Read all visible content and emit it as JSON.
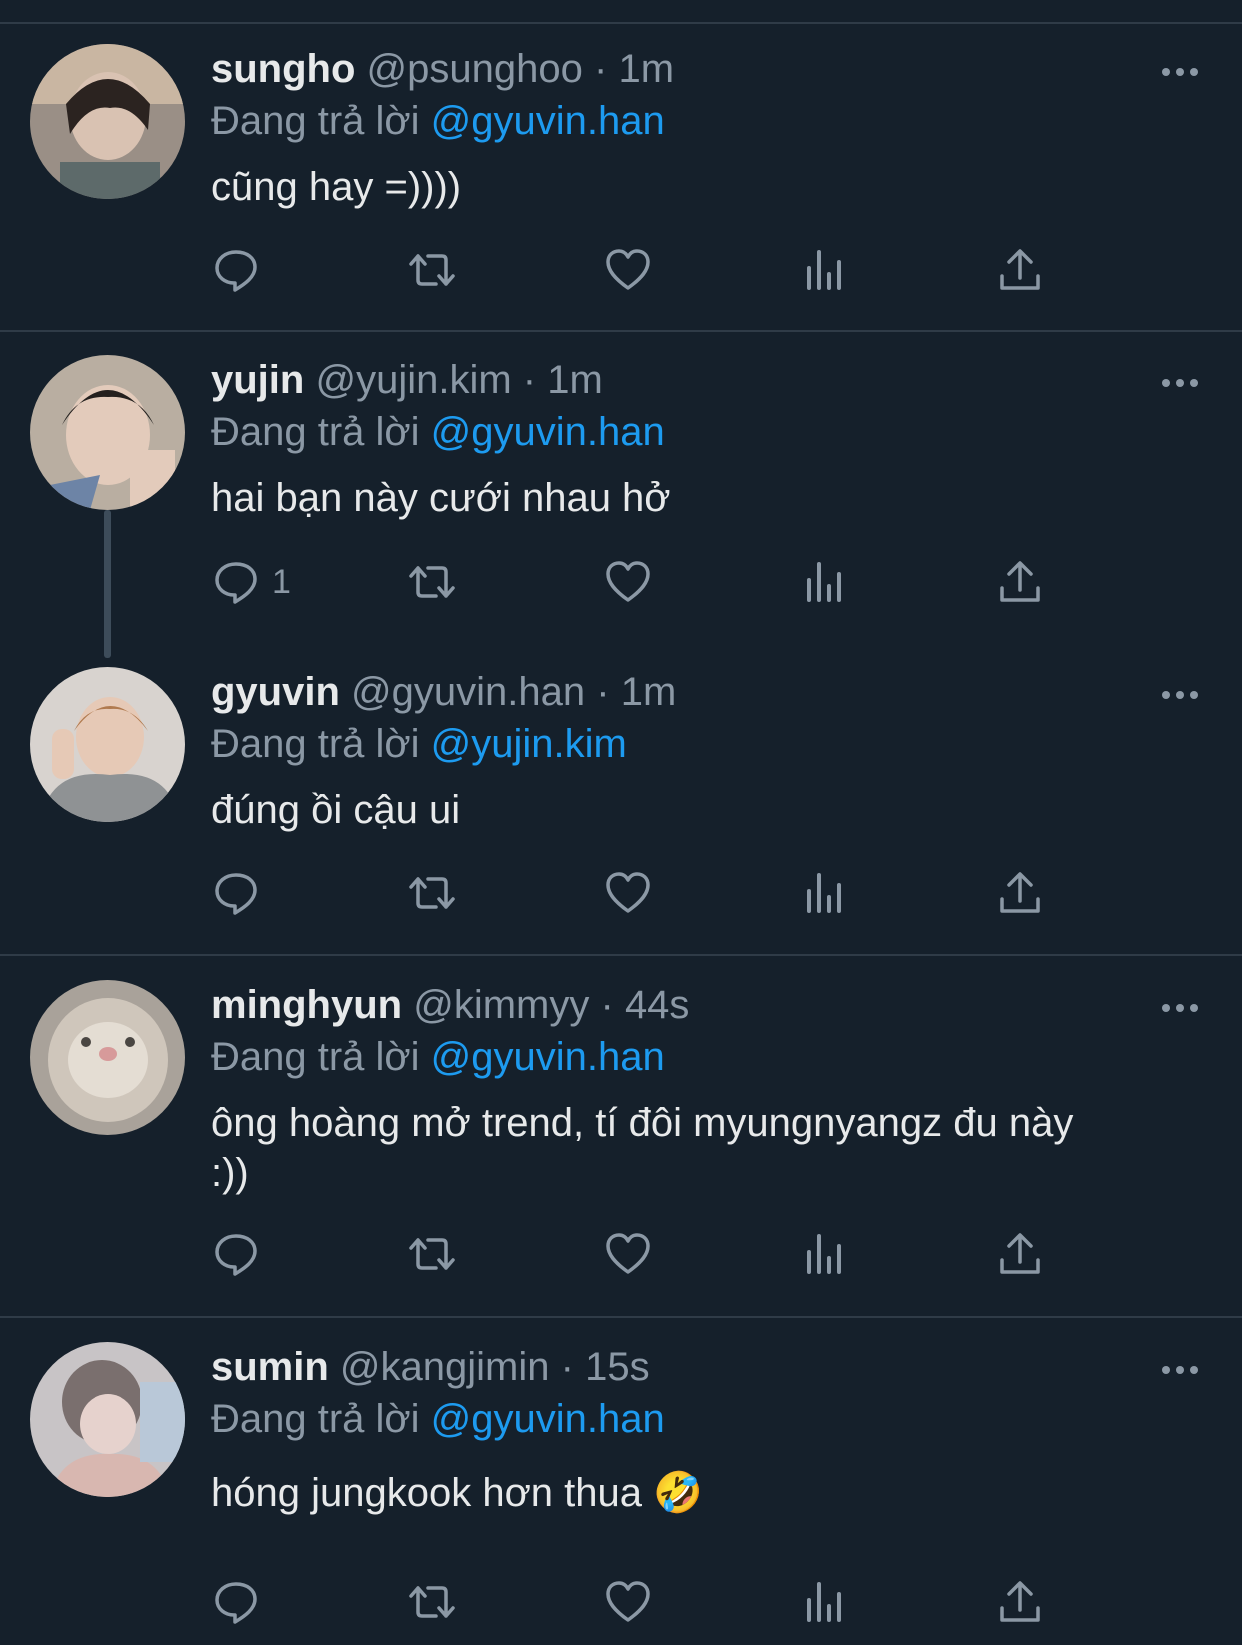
{
  "tweets": [
    {
      "name": "sungho",
      "handle": "@psunghoo",
      "time": "1m",
      "replying_label": "Đang trả lời",
      "replying_to": "@gyuvin.han",
      "text": "cũng hay =))))",
      "reply_count": ""
    },
    {
      "name": "yujin",
      "handle": "@yujin.kim",
      "time": "1m",
      "replying_label": "Đang trả lời",
      "replying_to": "@gyuvin.han",
      "text": "hai bạn này cưới nhau hở",
      "reply_count": "1"
    },
    {
      "name": "gyuvin",
      "handle": "@gyuvin.han",
      "time": "1m",
      "replying_label": "Đang trả lời",
      "replying_to": "@yujin.kim",
      "text": "đúng ồi cậu ui",
      "reply_count": ""
    },
    {
      "name": "minghyun",
      "handle": "@kimmyy",
      "time": "44s",
      "replying_label": "Đang trả lời",
      "replying_to": "@gyuvin.han",
      "text": "ông hoàng mở trend, tí đôi myungnyangz đu này :))",
      "reply_count": ""
    },
    {
      "name": "sumin",
      "handle": "@kangjimin",
      "time": "15s",
      "replying_label": "Đang trả lời",
      "replying_to": "@gyuvin.han",
      "text": "hóng jungkook hơn thua 🤣",
      "reply_count": ""
    }
  ],
  "separator": "·",
  "icons": [
    "reply-icon",
    "retweet-icon",
    "like-icon",
    "views-icon",
    "share-icon",
    "more-icon"
  ],
  "colors": {
    "background": "#15202b",
    "text": "#e7e9ea",
    "muted": "#8b98a5",
    "link": "#1d9bf0",
    "divider": "#2f3b47"
  }
}
